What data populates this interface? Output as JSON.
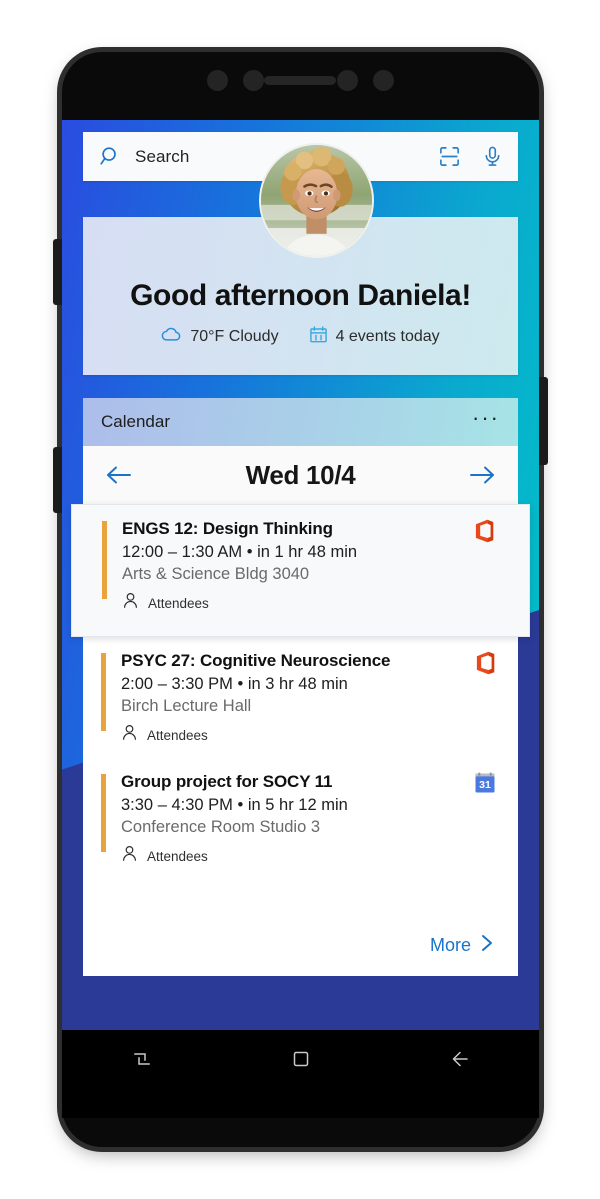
{
  "search": {
    "placeholder": "Search",
    "icon": "search-icon",
    "scan_icon": "scan-icon",
    "mic_icon": "microphone-icon"
  },
  "greeting": {
    "title": "Good afternoon Daniela!",
    "avatar_alt": "Daniela profile photo",
    "weather": {
      "icon": "cloud-icon",
      "text": "70°F Cloudy"
    },
    "events": {
      "icon": "calendar-icon",
      "text": "4 events today"
    }
  },
  "calendar": {
    "module_title": "Calendar",
    "overflow_label": "···",
    "prev_label": "previous-day",
    "next_label": "next-day",
    "date_label": "Wed 10/4",
    "more_label": "More",
    "accent_color": "#e8a33d",
    "link_color": "#1a73c8",
    "events": [
      {
        "title": "ENGS 12: Design Thinking",
        "time": "12:00 – 1:30 AM • in 1 hr 48 min",
        "location": "Arts & Science Bldg 3040",
        "attendees_label": "Attendees",
        "app_icon": "office-icon"
      },
      {
        "title": "PSYC 27: Cognitive Neuroscience",
        "time": "2:00 – 3:30 PM • in 3 hr 48 min",
        "location": "Birch Lecture Hall",
        "attendees_label": "Attendees",
        "app_icon": "office-icon"
      },
      {
        "title": "Group project for SOCY 11",
        "time": "3:30 – 4:30 PM • in 5 hr 12 min",
        "location": "Conference Room Studio 3",
        "attendees_label": "Attendees",
        "app_icon": "google-calendar-icon",
        "app_icon_day": "31"
      }
    ]
  },
  "nav_bar": {
    "recents_label": "recents",
    "home_label": "home",
    "back_label": "back"
  },
  "theme": {
    "gradient_start": "#2a4ce0",
    "gradient_mid": "#1675db",
    "gradient_end": "#00c6c6",
    "lower_background": "#2a3a96"
  }
}
